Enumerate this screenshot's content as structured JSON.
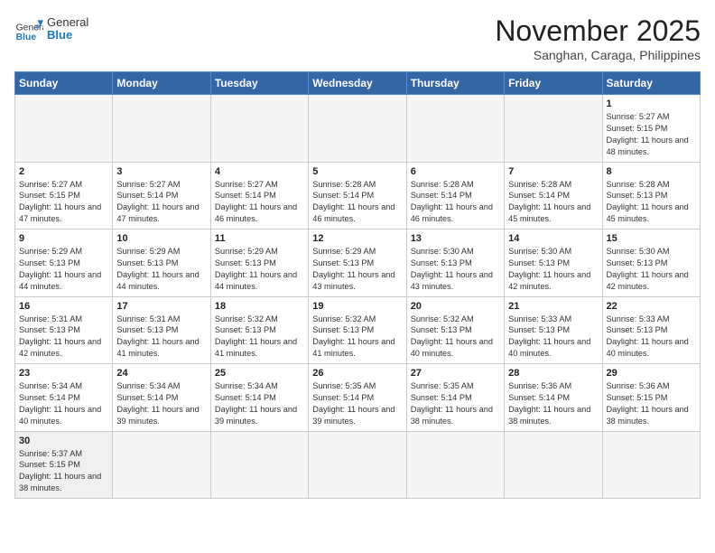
{
  "header": {
    "logo_general": "General",
    "logo_blue": "Blue",
    "month_title": "November 2025",
    "location": "Sanghan, Caraga, Philippines"
  },
  "weekdays": [
    "Sunday",
    "Monday",
    "Tuesday",
    "Wednesday",
    "Thursday",
    "Friday",
    "Saturday"
  ],
  "days": {
    "d1": {
      "n": "1",
      "sr": "5:27 AM",
      "ss": "5:15 PM",
      "dl": "11 hours and 48 minutes."
    },
    "d2": {
      "n": "2",
      "sr": "5:27 AM",
      "ss": "5:15 PM",
      "dl": "11 hours and 47 minutes."
    },
    "d3": {
      "n": "3",
      "sr": "5:27 AM",
      "ss": "5:14 PM",
      "dl": "11 hours and 47 minutes."
    },
    "d4": {
      "n": "4",
      "sr": "5:27 AM",
      "ss": "5:14 PM",
      "dl": "11 hours and 46 minutes."
    },
    "d5": {
      "n": "5",
      "sr": "5:28 AM",
      "ss": "5:14 PM",
      "dl": "11 hours and 46 minutes."
    },
    "d6": {
      "n": "6",
      "sr": "5:28 AM",
      "ss": "5:14 PM",
      "dl": "11 hours and 46 minutes."
    },
    "d7": {
      "n": "7",
      "sr": "5:28 AM",
      "ss": "5:14 PM",
      "dl": "11 hours and 45 minutes."
    },
    "d8": {
      "n": "8",
      "sr": "5:28 AM",
      "ss": "5:13 PM",
      "dl": "11 hours and 45 minutes."
    },
    "d9": {
      "n": "9",
      "sr": "5:29 AM",
      "ss": "5:13 PM",
      "dl": "11 hours and 44 minutes."
    },
    "d10": {
      "n": "10",
      "sr": "5:29 AM",
      "ss": "5:13 PM",
      "dl": "11 hours and 44 minutes."
    },
    "d11": {
      "n": "11",
      "sr": "5:29 AM",
      "ss": "5:13 PM",
      "dl": "11 hours and 44 minutes."
    },
    "d12": {
      "n": "12",
      "sr": "5:29 AM",
      "ss": "5:13 PM",
      "dl": "11 hours and 43 minutes."
    },
    "d13": {
      "n": "13",
      "sr": "5:30 AM",
      "ss": "5:13 PM",
      "dl": "11 hours and 43 minutes."
    },
    "d14": {
      "n": "14",
      "sr": "5:30 AM",
      "ss": "5:13 PM",
      "dl": "11 hours and 42 minutes."
    },
    "d15": {
      "n": "15",
      "sr": "5:30 AM",
      "ss": "5:13 PM",
      "dl": "11 hours and 42 minutes."
    },
    "d16": {
      "n": "16",
      "sr": "5:31 AM",
      "ss": "5:13 PM",
      "dl": "11 hours and 42 minutes."
    },
    "d17": {
      "n": "17",
      "sr": "5:31 AM",
      "ss": "5:13 PM",
      "dl": "11 hours and 41 minutes."
    },
    "d18": {
      "n": "18",
      "sr": "5:32 AM",
      "ss": "5:13 PM",
      "dl": "11 hours and 41 minutes."
    },
    "d19": {
      "n": "19",
      "sr": "5:32 AM",
      "ss": "5:13 PM",
      "dl": "11 hours and 41 minutes."
    },
    "d20": {
      "n": "20",
      "sr": "5:32 AM",
      "ss": "5:13 PM",
      "dl": "11 hours and 40 minutes."
    },
    "d21": {
      "n": "21",
      "sr": "5:33 AM",
      "ss": "5:13 PM",
      "dl": "11 hours and 40 minutes."
    },
    "d22": {
      "n": "22",
      "sr": "5:33 AM",
      "ss": "5:13 PM",
      "dl": "11 hours and 40 minutes."
    },
    "d23": {
      "n": "23",
      "sr": "5:34 AM",
      "ss": "5:14 PM",
      "dl": "11 hours and 40 minutes."
    },
    "d24": {
      "n": "24",
      "sr": "5:34 AM",
      "ss": "5:14 PM",
      "dl": "11 hours and 39 minutes."
    },
    "d25": {
      "n": "25",
      "sr": "5:34 AM",
      "ss": "5:14 PM",
      "dl": "11 hours and 39 minutes."
    },
    "d26": {
      "n": "26",
      "sr": "5:35 AM",
      "ss": "5:14 PM",
      "dl": "11 hours and 39 minutes."
    },
    "d27": {
      "n": "27",
      "sr": "5:35 AM",
      "ss": "5:14 PM",
      "dl": "11 hours and 38 minutes."
    },
    "d28": {
      "n": "28",
      "sr": "5:36 AM",
      "ss": "5:14 PM",
      "dl": "11 hours and 38 minutes."
    },
    "d29": {
      "n": "29",
      "sr": "5:36 AM",
      "ss": "5:15 PM",
      "dl": "11 hours and 38 minutes."
    },
    "d30": {
      "n": "30",
      "sr": "5:37 AM",
      "ss": "5:15 PM",
      "dl": "11 hours and 38 minutes."
    }
  },
  "labels": {
    "sunrise": "Sunrise:",
    "sunset": "Sunset:",
    "daylight": "Daylight:"
  }
}
